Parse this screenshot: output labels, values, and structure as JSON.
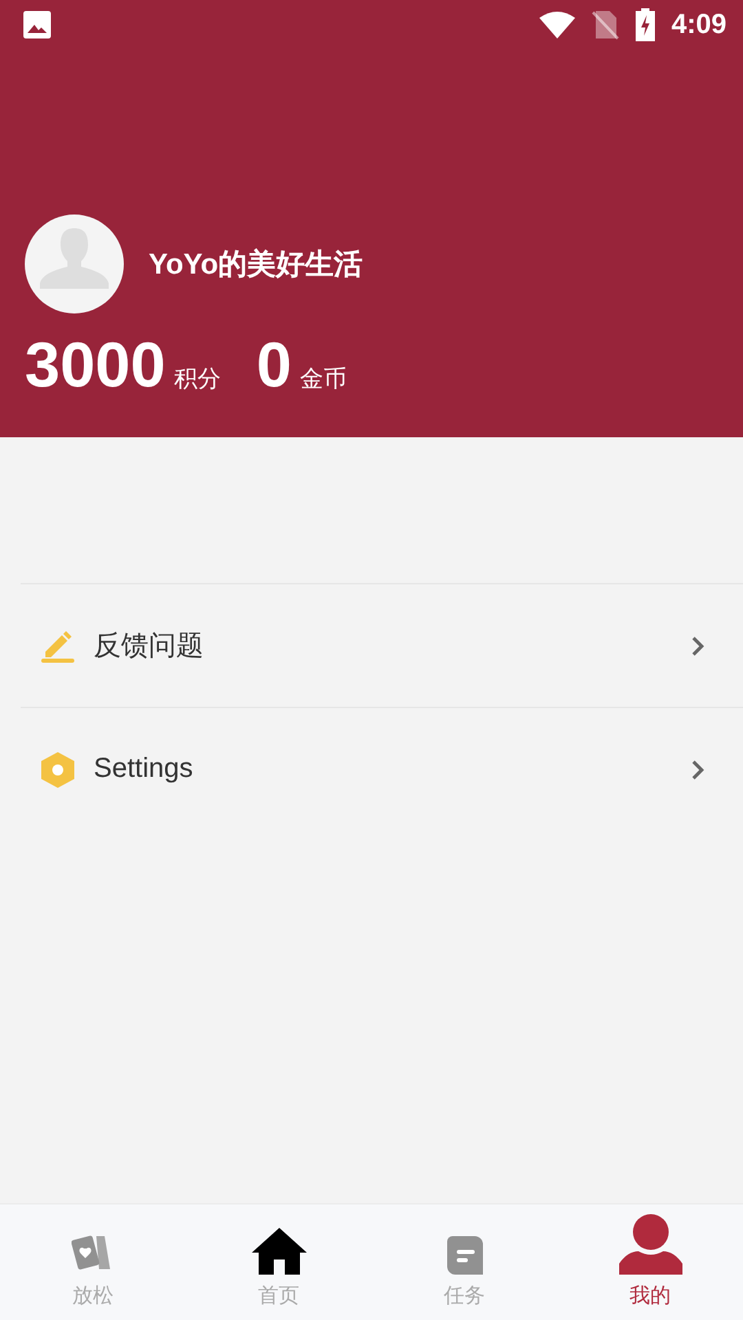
{
  "status_bar": {
    "time": "4:09"
  },
  "profile": {
    "name": "YoYo的美好生活",
    "stats": [
      {
        "value": "3000",
        "unit": "积分"
      },
      {
        "value": "0",
        "unit": "金币"
      }
    ]
  },
  "menu": [
    {
      "kind": "pencil",
      "label": "反馈问题"
    },
    {
      "kind": "hexagon",
      "label": "Settings"
    }
  ],
  "tabs": [
    {
      "kind": "cards",
      "label": "放松",
      "selected": false
    },
    {
      "kind": "home",
      "label": "首页",
      "selected": false
    },
    {
      "kind": "note",
      "label": "任务",
      "selected": false
    },
    {
      "kind": "person",
      "label": "我的",
      "selected": true
    }
  ]
}
